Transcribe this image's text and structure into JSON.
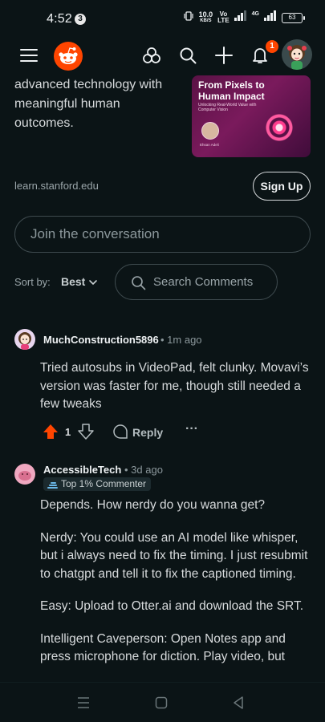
{
  "status_bar": {
    "time": "4:52",
    "notification_count": "3",
    "net_speed": "10.0",
    "net_unit": "KB/S",
    "net_label1": "Vo",
    "net_label2": "LTE",
    "net_label3": "4G",
    "battery": "63"
  },
  "header": {
    "notification_badge": "1",
    "icons": [
      "menu-icon",
      "reddit-logo-icon",
      "communities-icon",
      "search-icon",
      "create-post-icon",
      "notifications-icon",
      "user-avatar"
    ]
  },
  "ad": {
    "text": "advanced technology with meaningful human outcomes.",
    "card_title": "From Pixels to Human Impact",
    "card_subtitle": "Unlocking Real-World Value with Computer Vision",
    "card_name": "Ehsan Adeli",
    "domain": "learn.stanford.edu",
    "cta": "Sign Up"
  },
  "conversation": {
    "placeholder": "Join the conversation",
    "sort_label": "Sort by:",
    "sort_value": "Best",
    "search_comments": "Search Comments"
  },
  "comments": [
    {
      "author": "MuchConstruction5896",
      "time": "1m ago",
      "body": "Tried autosubs in VideoPad, felt clunky. Movavi’s version was faster for me, though still needed a few tweaks",
      "votes": "1",
      "reply": "Reply"
    },
    {
      "author": "AccessibleTech",
      "time": "3d ago",
      "flair": "Top 1% Commenter",
      "paragraphs": [
        "Depends. How nerdy do you wanna get?",
        "Nerdy: You could use an AI model like whisper, but i always need to fix the timing. I just resubmit to chatgpt and tell it to fix the captioned timing.",
        "Easy: Upload to Otter.ai and download the SRT.",
        "Intelligent Caveperson: Open Notes app and press microphone for diction. Play video, but"
      ]
    }
  ],
  "colors": {
    "background": "#0b1416",
    "upvote_active": "#ff4500",
    "notification_badge": "#ff4500"
  }
}
